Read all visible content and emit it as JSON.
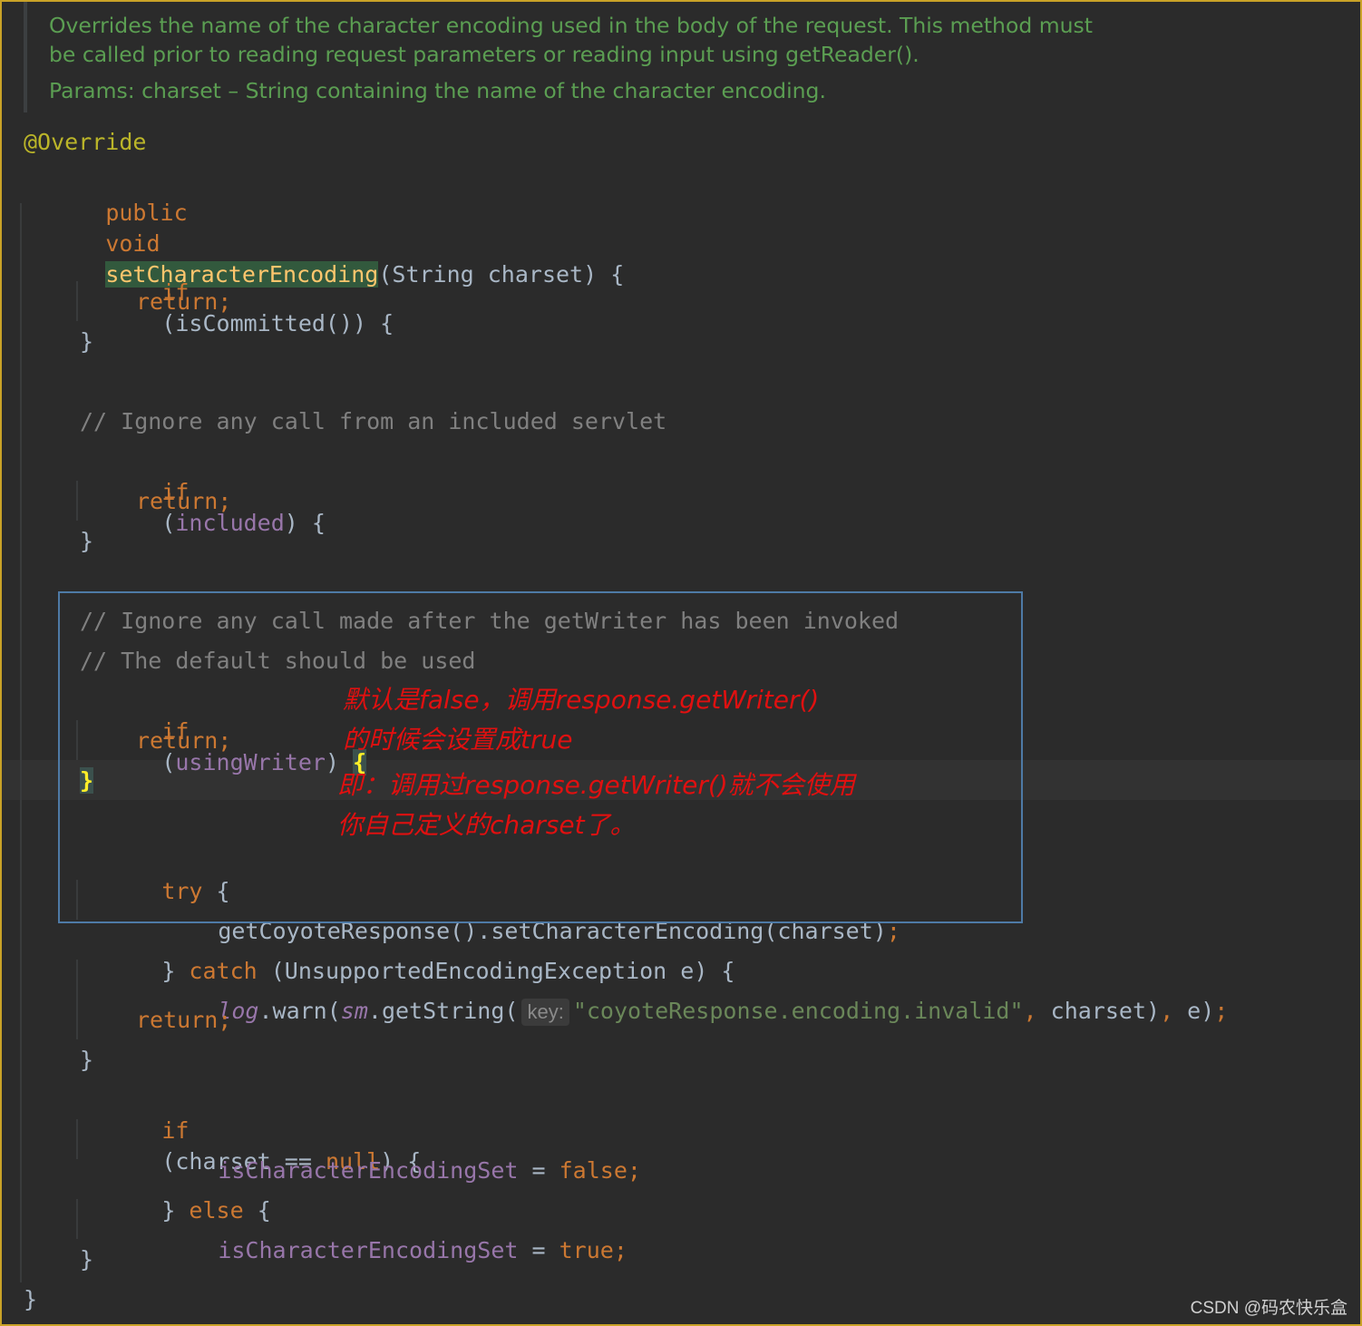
{
  "doc": {
    "line1": "Overrides the name of the character encoding used in the body of the request. This method must",
    "line2": "be called prior to reading request parameters or reading input using getReader().",
    "params": "Params: charset – String containing the name of the character encoding."
  },
  "code": {
    "annotation": "@Override",
    "public": "public",
    "void": "void",
    "method_name": "setCharacterEncoding",
    "signature_rest": "(String charset) {",
    "if": "if",
    "isCommitted": "(isCommitted()) {",
    "return": "return;",
    "close": "}",
    "comment1": "// Ignore any call from an included servlet",
    "paren_open": "(",
    "included": "included",
    "paren_close_brace": ") {",
    "comment2": "// Ignore any call made after the getWriter has been invoked",
    "comment3": "// The default should be used",
    "usingWriter": "usingWriter",
    "paren_close": ") ",
    "open_brace": "{",
    "try": "try",
    "try_brace": " {",
    "coyote_call": "getCoyoteResponse().setCharacterEncoding(charset)",
    "semicolon": ";",
    "catch": "catch",
    "catch_rest": " (UnsupportedEncodingException e) {",
    "log": "log",
    "warn": ".warn(",
    "sm": "sm",
    "getString": ".getString(",
    "hint_key": "key:",
    "string_literal": "\"coyoteResponse.encoding.invalid\"",
    "comma": ",",
    "charset_arg": " charset)",
    "e_arg": " e)",
    "charset_null_open": "(charset == ",
    "null": "null",
    "charset_null_close": ") {",
    "isCharacterEncodingSet": "isCharacterEncodingSet",
    "assign": " = ",
    "false": "false",
    "true": "true",
    "else": "else",
    "close_brace": "} ",
    "final_close": "}"
  },
  "annotations": {
    "note1": "默认是false，调用response.getWriter()",
    "note2": "的时候会设置成true",
    "note3": "即：调用过response.getWriter()就不会使用",
    "note4": "你自己定义的charset了。"
  },
  "watermark": "CSDN @码农快乐盒"
}
